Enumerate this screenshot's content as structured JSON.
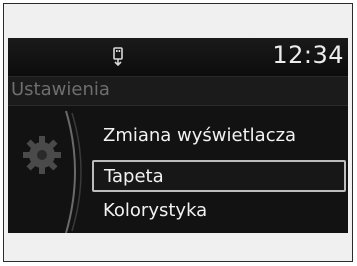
{
  "status": {
    "time": "12:34",
    "usb_icon": "usb-icon"
  },
  "screen": {
    "title": "Ustawienia",
    "section_icon": "gear-icon"
  },
  "menu": {
    "items": [
      {
        "label": "Zmiana wyświetlacza",
        "selected": false
      },
      {
        "label": "Tapeta",
        "selected": true
      },
      {
        "label": "Kolorystyka",
        "selected": false
      }
    ]
  },
  "colors": {
    "screen_bg": "#121212",
    "text": "#f2f2f2",
    "title_text": "#6e6e6e",
    "selection_border": "#bdbdbd"
  }
}
